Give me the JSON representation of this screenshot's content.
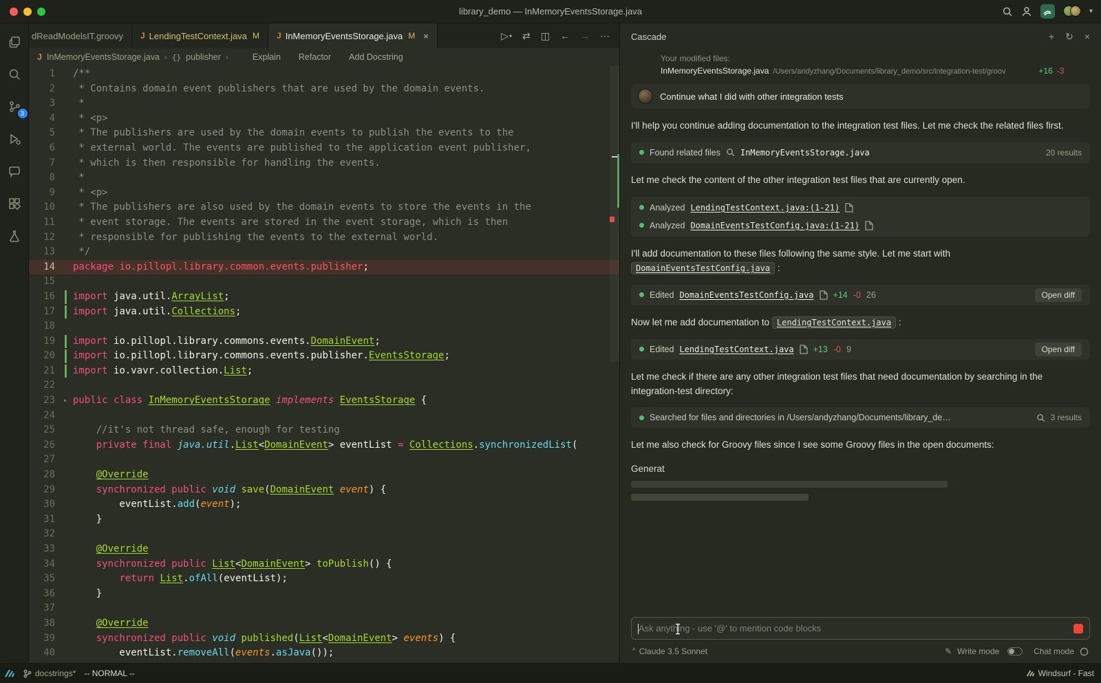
{
  "window": {
    "title": "library_demo — InMemoryEventsStorage.java"
  },
  "activity": {
    "scm_badge": "3"
  },
  "icons": {
    "plus": "+",
    "history": "↻",
    "close": "×",
    "run": "▷",
    "run_dd": "▾",
    "compare": "⇄",
    "split": "◫",
    "back": "←",
    "forward": "→",
    "more": "⋯",
    "crumb_sep": "›",
    "braces": "{}",
    "chevron_up": "^",
    "pencil": "✎",
    "chevron_down": "▾"
  },
  "tabs": [
    {
      "label": "dReadModelsIT.groovy",
      "modified": ""
    },
    {
      "label": "LendingTestContext.java",
      "modified": "M"
    },
    {
      "label": "InMemoryEventsStorage.java",
      "modified": "M"
    }
  ],
  "breadcrumb": {
    "file": "InMemoryEventsStorage.java",
    "symbol": "publisher",
    "lens": [
      "Explain",
      "Refactor",
      "Add Docstring"
    ]
  },
  "editor": {
    "lines": [
      {
        "n": 1,
        "t": [
          [
            "c",
            "/**"
          ]
        ]
      },
      {
        "n": 2,
        "t": [
          [
            "c",
            " * Contains domain event publishers that are used by the domain events."
          ]
        ]
      },
      {
        "n": 3,
        "t": [
          [
            "c",
            " *"
          ]
        ]
      },
      {
        "n": 4,
        "t": [
          [
            "c",
            " * <p>"
          ]
        ]
      },
      {
        "n": 5,
        "t": [
          [
            "c",
            " * The publishers are used by the domain events to publish the events to the"
          ]
        ]
      },
      {
        "n": 6,
        "t": [
          [
            "c",
            " * external world. The events are published to the application event publisher,"
          ]
        ]
      },
      {
        "n": 7,
        "t": [
          [
            "c",
            " * which is then responsible for handling the events."
          ]
        ]
      },
      {
        "n": 8,
        "t": [
          [
            "c",
            " *"
          ]
        ]
      },
      {
        "n": 9,
        "t": [
          [
            "c",
            " * <p>"
          ]
        ]
      },
      {
        "n": 10,
        "t": [
          [
            "c",
            " * The publishers are also used by the domain events to store the events in the"
          ]
        ]
      },
      {
        "n": 11,
        "t": [
          [
            "c",
            " * event storage. The events are stored in the event storage, which is then"
          ]
        ]
      },
      {
        "n": 12,
        "t": [
          [
            "c",
            " * responsible for publishing the events to the external world."
          ]
        ]
      },
      {
        "n": 13,
        "t": [
          [
            "c",
            " */"
          ]
        ],
        "bulb": true
      },
      {
        "n": 14,
        "t": [
          [
            "k",
            "package "
          ],
          [
            "r",
            "io.pillopl.library.common.events.publisher"
          ],
          [
            "w",
            ";"
          ]
        ],
        "hl": true
      },
      {
        "n": 15,
        "t": []
      },
      {
        "n": 16,
        "t": [
          [
            "k",
            "import "
          ],
          [
            "w",
            "java.util."
          ],
          [
            "t",
            "ArrayList"
          ],
          [
            "w",
            ";"
          ]
        ],
        "git": true
      },
      {
        "n": 17,
        "t": [
          [
            "k",
            "import "
          ],
          [
            "w",
            "java.util."
          ],
          [
            "t",
            "Collections"
          ],
          [
            "w",
            ";"
          ]
        ],
        "git": true
      },
      {
        "n": 18,
        "t": []
      },
      {
        "n": 19,
        "t": [
          [
            "k",
            "import "
          ],
          [
            "w",
            "io.pillopl.library.commons.events."
          ],
          [
            "t",
            "DomainEvent"
          ],
          [
            "w",
            ";"
          ]
        ],
        "git": true
      },
      {
        "n": 20,
        "t": [
          [
            "k",
            "import "
          ],
          [
            "w",
            "io.pillopl.library.commons.events.publisher."
          ],
          [
            "t",
            "EventsStorage"
          ],
          [
            "w",
            ";"
          ]
        ],
        "git": true
      },
      {
        "n": 21,
        "t": [
          [
            "k",
            "import "
          ],
          [
            "w",
            "io.vavr.collection."
          ],
          [
            "t",
            "List"
          ],
          [
            "w",
            ";"
          ]
        ],
        "git": true
      },
      {
        "n": 22,
        "t": []
      },
      {
        "n": 23,
        "t": [
          [
            "k",
            "public class "
          ],
          [
            "t",
            "InMemoryEventsStorage"
          ],
          [
            "ki",
            " implements "
          ],
          [
            "t",
            "EventsStorage"
          ],
          [
            "w",
            " {"
          ]
        ],
        "mark": true
      },
      {
        "n": 24,
        "t": []
      },
      {
        "n": 25,
        "t": [
          [
            "w",
            "    "
          ],
          [
            "c",
            "//it's not thread safe, enough for testing"
          ]
        ]
      },
      {
        "n": 26,
        "t": [
          [
            "w",
            "    "
          ],
          [
            "k",
            "private final "
          ],
          [
            "ti",
            "java.util"
          ],
          [
            "w",
            "."
          ],
          [
            "t",
            "List"
          ],
          [
            "w",
            "<"
          ],
          [
            "t",
            "DomainEvent"
          ],
          [
            "w",
            "> eventList "
          ],
          [
            "k",
            "= "
          ],
          [
            "t",
            "Collections"
          ],
          [
            "w",
            "."
          ],
          [
            "m",
            "synchronizedList"
          ],
          [
            "w",
            "("
          ]
        ]
      },
      {
        "n": 27,
        "t": []
      },
      {
        "n": 28,
        "t": [
          [
            "w",
            "    "
          ],
          [
            "t",
            "@Override"
          ]
        ]
      },
      {
        "n": 29,
        "t": [
          [
            "w",
            "    "
          ],
          [
            "k",
            "synchronized public "
          ],
          [
            "ti",
            "void"
          ],
          [
            "w",
            " "
          ],
          [
            "f",
            "save"
          ],
          [
            "w",
            "("
          ],
          [
            "t",
            "DomainEvent"
          ],
          [
            "w",
            " "
          ],
          [
            "p",
            "event"
          ],
          [
            "w",
            ") {"
          ]
        ]
      },
      {
        "n": 30,
        "t": [
          [
            "w",
            "        eventList."
          ],
          [
            "m",
            "add"
          ],
          [
            "w",
            "("
          ],
          [
            "p",
            "event"
          ],
          [
            "w",
            ");"
          ]
        ]
      },
      {
        "n": 31,
        "t": [
          [
            "w",
            "    }"
          ]
        ]
      },
      {
        "n": 32,
        "t": []
      },
      {
        "n": 33,
        "t": [
          [
            "w",
            "    "
          ],
          [
            "t",
            "@Override"
          ]
        ]
      },
      {
        "n": 34,
        "t": [
          [
            "w",
            "    "
          ],
          [
            "k",
            "synchronized public "
          ],
          [
            "t",
            "List"
          ],
          [
            "w",
            "<"
          ],
          [
            "t",
            "DomainEvent"
          ],
          [
            "w",
            "> "
          ],
          [
            "f",
            "toPublish"
          ],
          [
            "w",
            "() {"
          ]
        ]
      },
      {
        "n": 35,
        "t": [
          [
            "w",
            "        "
          ],
          [
            "k",
            "return "
          ],
          [
            "t",
            "List"
          ],
          [
            "w",
            "."
          ],
          [
            "m",
            "ofAll"
          ],
          [
            "w",
            "(eventList);"
          ]
        ]
      },
      {
        "n": 36,
        "t": [
          [
            "w",
            "    }"
          ]
        ]
      },
      {
        "n": 37,
        "t": []
      },
      {
        "n": 38,
        "t": [
          [
            "w",
            "    "
          ],
          [
            "t",
            "@Override"
          ]
        ]
      },
      {
        "n": 39,
        "t": [
          [
            "w",
            "    "
          ],
          [
            "k",
            "synchronized public "
          ],
          [
            "ti",
            "void"
          ],
          [
            "w",
            " "
          ],
          [
            "f",
            "published"
          ],
          [
            "w",
            "("
          ],
          [
            "t",
            "List"
          ],
          [
            "w",
            "<"
          ],
          [
            "t",
            "DomainEvent"
          ],
          [
            "w",
            "> "
          ],
          [
            "p",
            "events"
          ],
          [
            "w",
            ") {"
          ]
        ]
      },
      {
        "n": 40,
        "t": [
          [
            "w",
            "        eventList."
          ],
          [
            "m",
            "removeAll"
          ],
          [
            "w",
            "("
          ],
          [
            "p",
            "events"
          ],
          [
            "w",
            "."
          ],
          [
            "m",
            "asJava"
          ],
          [
            "w",
            "());"
          ]
        ]
      }
    ]
  },
  "cascade": {
    "title": "Cascade",
    "modified_files_label": "Your modified files:",
    "modified_file": {
      "name": "InMemoryEventsStorage.java",
      "path": "/Users/andyzhang/Documents/library_demo/src/integration-test/groov",
      "added": "+16",
      "removed": "-3"
    },
    "user_message": "Continue what I did with other integration tests",
    "p1": "I'll help you continue adding documentation to the integration test files. Let me check the related files first.",
    "tool_found": {
      "label": "Found related files",
      "query": "InMemoryEventsStorage.java",
      "results": "20 results"
    },
    "p2": "Let me check the content of the other integration test files that are currently open.",
    "analyzed1": {
      "label": "Analyzed",
      "file": "LendingTestContext.java:(1-21)"
    },
    "analyzed2": {
      "label": "Analyzed",
      "file": "DomainEventsTestConfig.java:(1-21)"
    },
    "p3a": "I'll add documentation to these files following the same style. Let me start with",
    "p3chip": "DomainEventsTestConfig.java",
    "p3b": ":",
    "edit1": {
      "label": "Edited",
      "file": "DomainEventsTestConfig.java",
      "added": "+14",
      "removed": "-0",
      "lines": "26",
      "button": "Open diff"
    },
    "p4a": "Now let me add documentation to",
    "p4chip": "LendingTestContext.java",
    "p4b": ":",
    "edit2": {
      "label": "Edited",
      "file": "LendingTestContext.java",
      "added": "+13",
      "removed": "-0",
      "lines": "9",
      "button": "Open diff"
    },
    "p5": "Let me check if there are any other integration test files that need documentation by searching in the integration-test directory:",
    "tool_search": {
      "label": "Searched for files and directories in /Users/andyzhang/Documents/library_dem...",
      "results": "3 results"
    },
    "p6": "Let me also check for Groovy files since I see some Groovy files in the open documents:",
    "streaming": "Generat",
    "input_placeholder": "Ask anything - use '@' to mention code blocks",
    "model": "Claude 3.5 Sonnet",
    "write_mode": "Write mode",
    "chat_mode": "Chat mode"
  },
  "statusbar": {
    "branch": "docstrings*",
    "mode": "-- NORMAL --",
    "right": "Windsurf - Fast"
  }
}
